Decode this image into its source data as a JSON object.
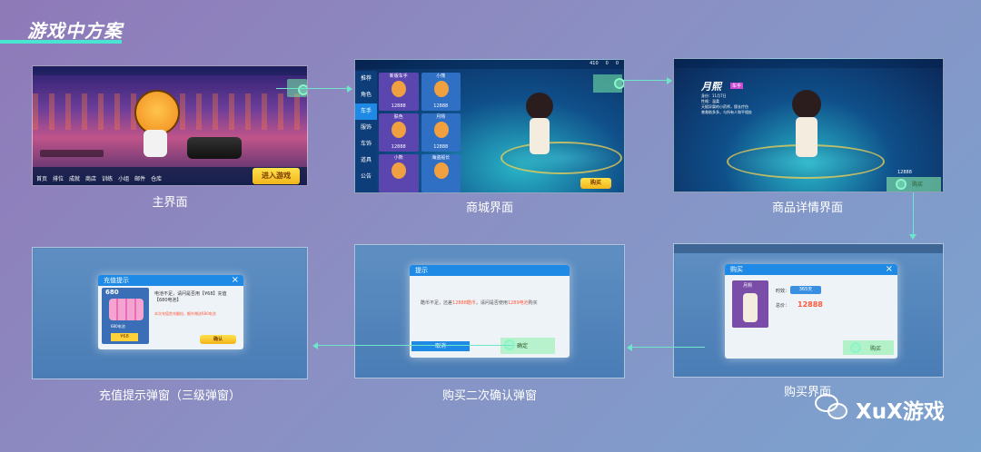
{
  "heading": "游戏中方案",
  "screens": {
    "main": {
      "caption": "主界面",
      "start_button": "进入游戏",
      "menu_items": [
        "首页",
        "排位",
        "成就",
        "商店",
        "训练",
        "小组",
        "邮件",
        "仓库"
      ]
    },
    "store": {
      "caption": "商城界面",
      "tabs": [
        "推荐",
        "角色",
        "车手",
        "服饰",
        "车饰",
        "道具",
        "公告"
      ],
      "items": [
        {
          "name": "新版车手",
          "price": "12888"
        },
        {
          "name": "小熊",
          "price": "12888"
        },
        {
          "name": "肤色",
          "price": "12888"
        },
        {
          "name": "月熙",
          "price": "12888"
        },
        {
          "name": "小熊",
          "price": ""
        },
        {
          "name": "海盗船长",
          "price": ""
        }
      ],
      "currency_values": [
        "410",
        "0",
        "0"
      ],
      "buy_label": "购买"
    },
    "detail": {
      "caption": "商品详情界面",
      "name": "月熙",
      "tag": "车手",
      "desc_lines": [
        "身份：11月7日",
        "性格：温柔",
        "天赋异禀的小药师，擅长疗伤",
        "曾救助多多，与所有人和平相处"
      ],
      "price": "12888",
      "buy_label": "购买"
    },
    "purchase": {
      "caption": "购买界面",
      "title": "购买",
      "item_name": "月熙",
      "duration_label": "时效：",
      "duration_value": "365天",
      "price_label": "总价：",
      "price_value": "12888",
      "confirm_label": "购买"
    },
    "confirm": {
      "caption": "购买二次确认弹窗",
      "title": "提示",
      "message_prefix": "酷币不足，还差",
      "message_amount": "12888酷币",
      "message_mid": "，请问是否使用",
      "message_amount2": "1289电池",
      "message_suffix": "购买",
      "cancel_label": "取消",
      "ok_label": "确定"
    },
    "recharge": {
      "caption": "充值提示弹窗（三级弹窗）",
      "title": "充值提示",
      "amount": "680",
      "pack_label": "680电池",
      "price": "¥68",
      "message": "电池不足，请问是否用【¥68】充值【680电池】",
      "note": "本次充值首充翻倍，额外赠送680电池",
      "ok_label": "确认"
    }
  },
  "watermark": "XuX游戏",
  "colors": {
    "accent": "#48e6d0",
    "arrow": "#6fe6c9",
    "popup_head": "#1e8ae6",
    "price_red": "#ff5a3c"
  }
}
